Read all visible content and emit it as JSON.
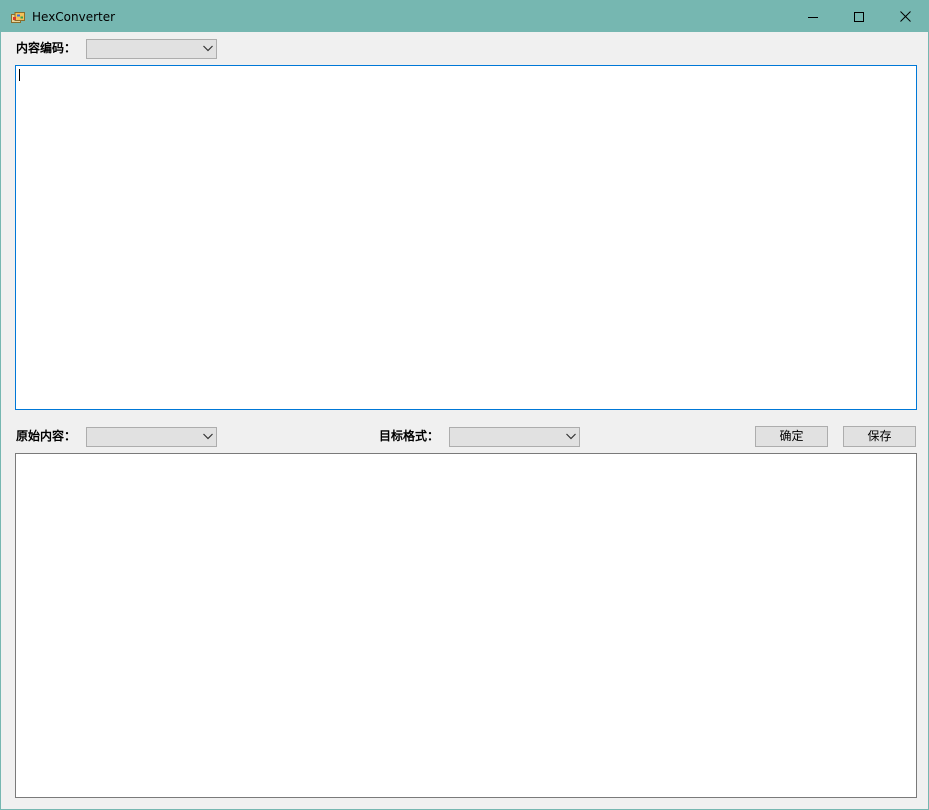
{
  "window": {
    "title": "HexConverter",
    "controls": {
      "minimize_icon": "minimize-icon",
      "maximize_icon": "maximize-icon",
      "close_icon": "close-icon"
    }
  },
  "encoding": {
    "label": "内容编码：",
    "value": ""
  },
  "input_text": {
    "value": ""
  },
  "source": {
    "label": "原始内容：",
    "value": ""
  },
  "target": {
    "label": "目标格式：",
    "value": ""
  },
  "buttons": {
    "confirm": "确定",
    "save": "保存"
  },
  "output_text": {
    "value": ""
  },
  "colors": {
    "titlebar": "#76b7b1",
    "focus_border": "#0078d7",
    "window_bg": "#f0f0f0"
  }
}
